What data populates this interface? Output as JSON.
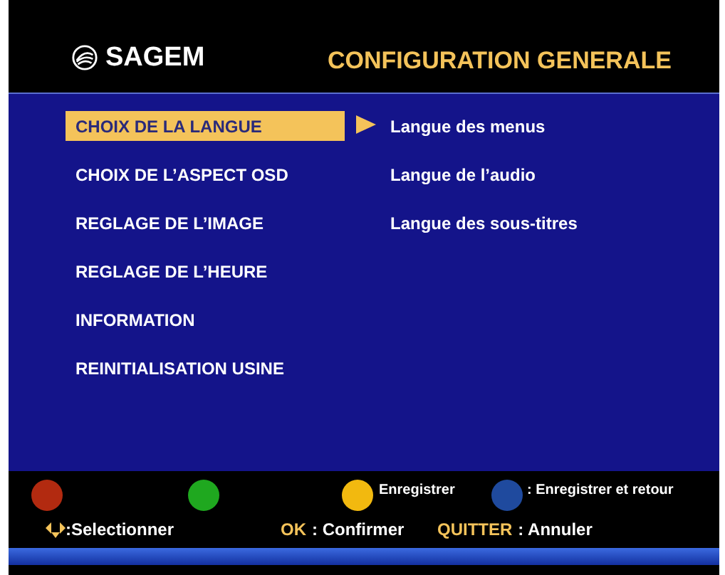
{
  "header": {
    "logo": "SAGEM",
    "title": "CONFIGURATION GENERALE"
  },
  "menu": [
    {
      "label": "CHOIX DE LA LANGUE",
      "selected": true
    },
    {
      "label": "CHOIX DE L’ASPECT OSD",
      "selected": false
    },
    {
      "label": "REGLAGE DE L’IMAGE",
      "selected": false
    },
    {
      "label": "REGLAGE DE L’HEURE",
      "selected": false
    },
    {
      "label": "INFORMATION",
      "selected": false
    },
    {
      "label": "REINITIALISATION USINE",
      "selected": false
    }
  ],
  "submenu": [
    "Langue des menus",
    "Langue de l’audio",
    "Langue des sous-titres"
  ],
  "color_keys": [
    {
      "color": "#b22a10"
    },
    {
      "color": "#1fa81f"
    },
    {
      "color": "#f2b90f",
      "label": "Enregistrer"
    },
    {
      "color": "#1f4a9e",
      "label": ": Enregistrer et retour"
    }
  ],
  "hints": [
    {
      "kind": "arrows",
      "label": ":Selectionner"
    },
    {
      "kind": "key",
      "key": "OK",
      "label": ": Confirmer"
    },
    {
      "kind": "key",
      "key": "QUITTER",
      "label": ": Annuler"
    }
  ]
}
